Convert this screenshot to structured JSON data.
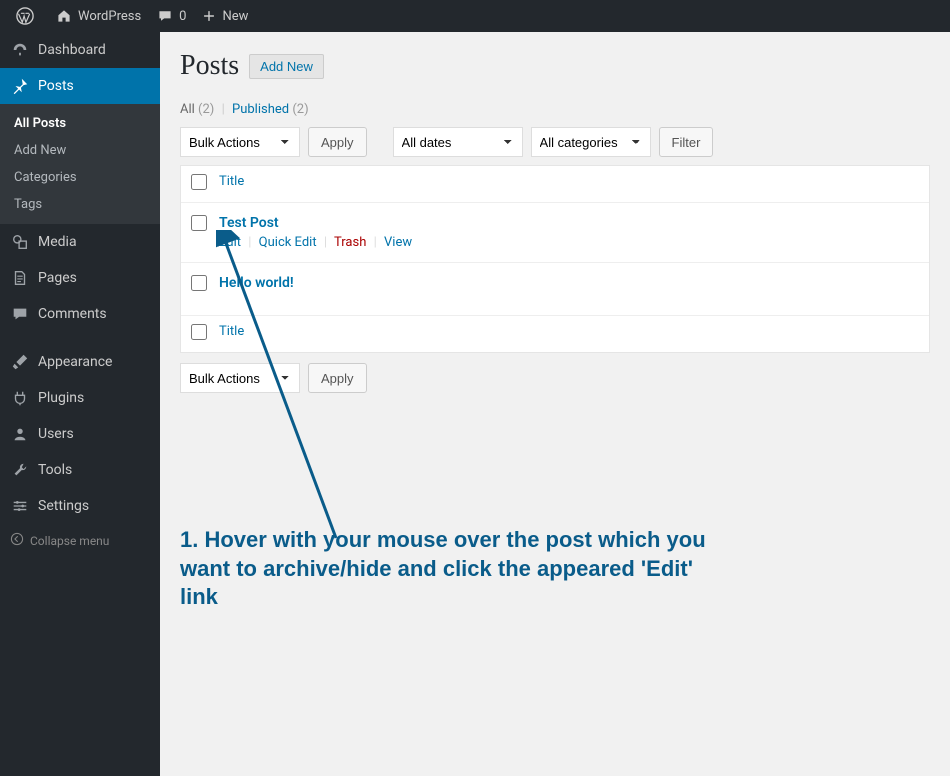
{
  "adminbar": {
    "site_name": "WordPress",
    "comments_count": "0",
    "new_label": "New"
  },
  "sidebar": {
    "dashboard": "Dashboard",
    "posts": "Posts",
    "media": "Media",
    "pages": "Pages",
    "comments": "Comments",
    "appearance": "Appearance",
    "plugins": "Plugins",
    "users": "Users",
    "tools": "Tools",
    "settings": "Settings",
    "collapse": "Collapse menu",
    "submenu": {
      "all_posts": "All Posts",
      "add_new": "Add New",
      "categories": "Categories",
      "tags": "Tags"
    }
  },
  "page": {
    "heading": "Posts",
    "add_new": "Add New"
  },
  "views": {
    "all_label": "All",
    "all_count": "(2)",
    "published_label": "Published",
    "published_count": "(2)"
  },
  "filters": {
    "bulk_actions": "Bulk Actions",
    "apply": "Apply",
    "all_dates": "All dates",
    "all_categories": "All categories",
    "filter": "Filter"
  },
  "table": {
    "title_col": "Title",
    "posts": [
      {
        "title": "Test Post"
      },
      {
        "title": "Hello world!"
      }
    ],
    "actions": {
      "edit": "Edit",
      "quick_edit": "Quick Edit",
      "trash": "Trash",
      "view": "View"
    }
  },
  "annotation": {
    "text": "1. Hover with your mouse over the post which you want to archive/hide and click the appeared 'Edit' link"
  }
}
